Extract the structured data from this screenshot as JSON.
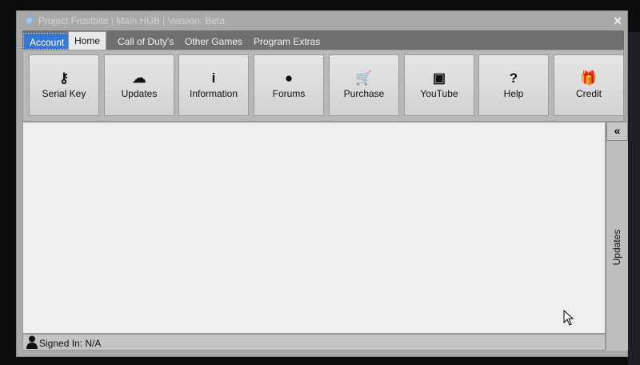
{
  "window": {
    "title": "Project Frostbite | Main HUB | Version: Beta",
    "close": "✕"
  },
  "tabs": [
    {
      "label": "Account"
    },
    {
      "label": "Home"
    },
    {
      "label": "Call of Duty's"
    },
    {
      "label": "Other Games"
    },
    {
      "label": "Program Extras"
    }
  ],
  "buttons": [
    {
      "label": "Serial Key",
      "icon": "key-icon",
      "glyph": "⚷"
    },
    {
      "label": "Updates",
      "icon": "cloud-download-icon",
      "glyph": "☁"
    },
    {
      "label": "Information",
      "icon": "info-icon",
      "glyph": "i"
    },
    {
      "label": "Forums",
      "icon": "globe-icon",
      "glyph": "●"
    },
    {
      "label": "Purchase",
      "icon": "cart-icon",
      "glyph": "🛒"
    },
    {
      "label": "YouTube",
      "icon": "youtube-icon",
      "glyph": "▣"
    },
    {
      "label": "Help",
      "icon": "question-icon",
      "glyph": "?"
    },
    {
      "label": "Credit",
      "icon": "gift-icon",
      "glyph": "🎁"
    }
  ],
  "side_panel": {
    "collapse": "«",
    "label": "Updates"
  },
  "status": {
    "signed_in": "Signed In: N/A"
  }
}
